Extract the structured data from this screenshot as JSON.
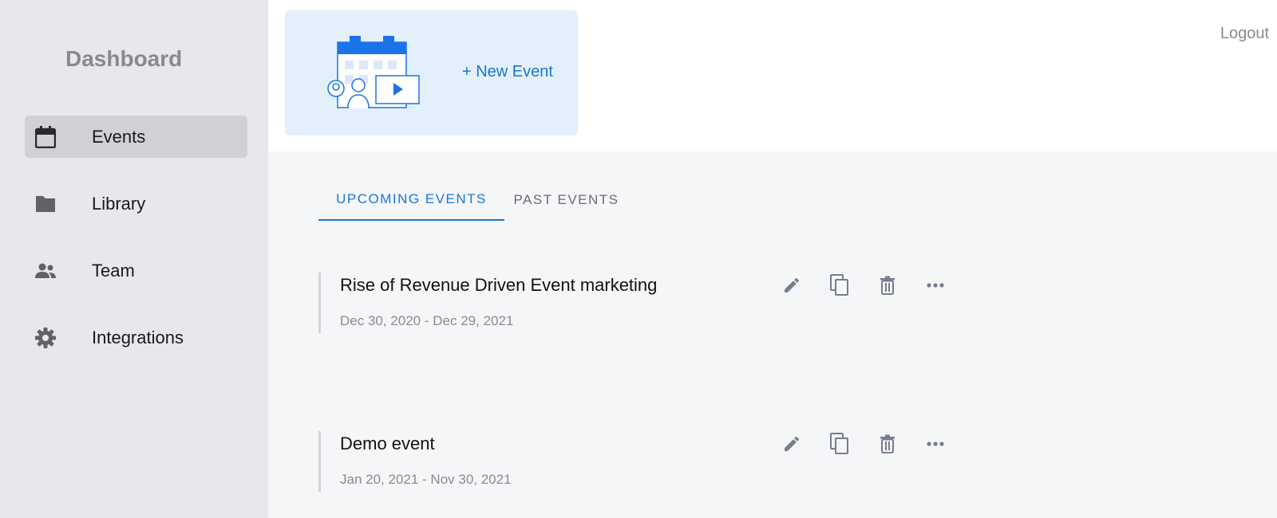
{
  "sidebar": {
    "title": "Dashboard",
    "items": [
      {
        "label": "Events",
        "icon": "calendar-icon",
        "active": true
      },
      {
        "label": "Library",
        "icon": "folder-icon",
        "active": false
      },
      {
        "label": "Team",
        "icon": "people-icon",
        "active": false
      },
      {
        "label": "Integrations",
        "icon": "gear-icon",
        "active": false
      }
    ]
  },
  "header": {
    "new_event_label": "+ New Event",
    "logout_label": "Logout"
  },
  "tabs": [
    {
      "label": "UPCOMING EVENTS",
      "active": true
    },
    {
      "label": "PAST EVENTS",
      "active": false
    }
  ],
  "events": [
    {
      "title": "Rise of Revenue Driven Event marketing",
      "dates": "Dec 30, 2020 - Dec 29, 2021"
    },
    {
      "title": "Demo event",
      "dates": "Jan 20, 2021 - Nov 30, 2021"
    }
  ],
  "colors": {
    "accent": "#1976d2",
    "sidebar_bg": "#e8e8ec",
    "card_bg": "#e3f0fb",
    "icon_gray": "#616166",
    "action_gray": "#7a7a90"
  }
}
